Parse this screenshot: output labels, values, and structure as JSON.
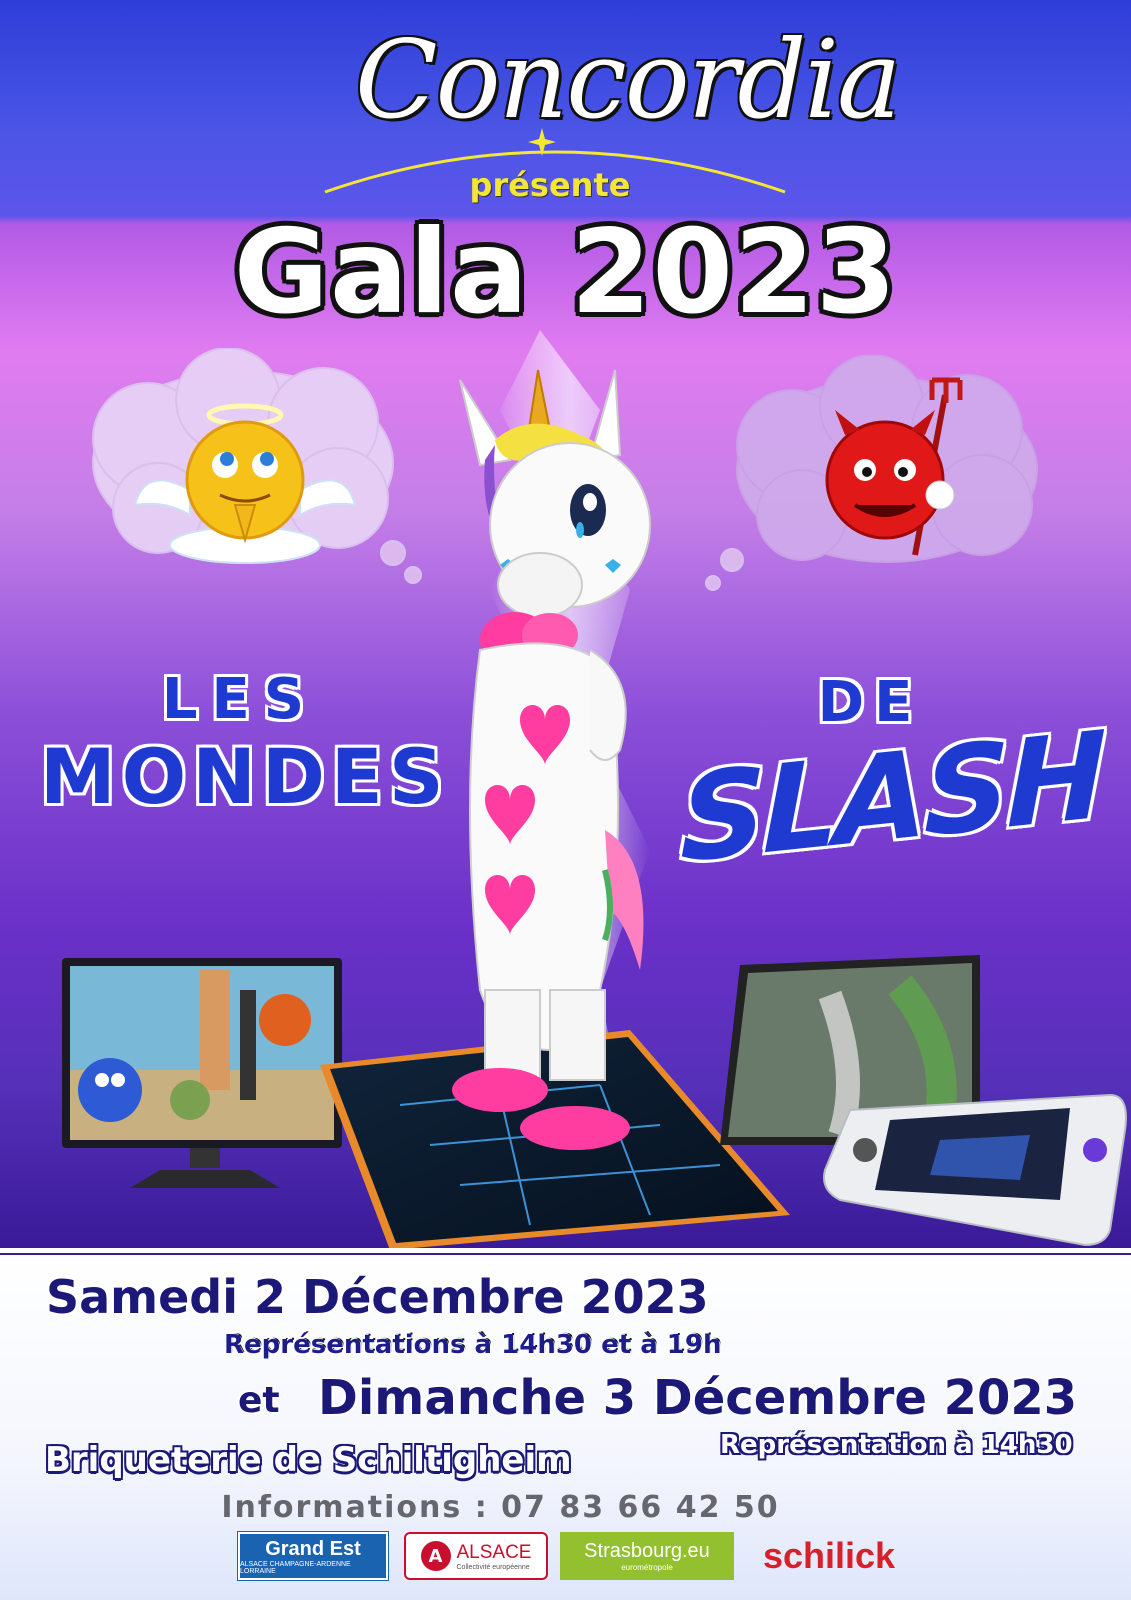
{
  "header": {
    "brand": "Concordia",
    "presents": "présente",
    "title": "Gala 2023"
  },
  "show": {
    "title_line1": "LES",
    "title_line2": "MONDES",
    "title_line3": "DE",
    "title_line4": "SLASH"
  },
  "dates": {
    "saturday": "Samedi 2 Décembre 2023",
    "saturday_times": "Représentations à 14h30 et à 19h",
    "conjunction": "et",
    "sunday": "Dimanche 3 Décembre 2023",
    "sunday_times": "Représentation à 14h30",
    "venue": "Briqueterie de Schiltigheim"
  },
  "info": "Informations : 07 83 66 42 50",
  "sponsors": {
    "grandest": "Grand Est",
    "grandest_sub": "ALSACE CHAMPAGNE-ARDENNE LORRAINE",
    "alsace": "ALSACE",
    "alsace_sub": "Collectivité européenne",
    "strasbourg": "Strasbourg.eu",
    "strasbourg_sub": "eurométropole",
    "schilick": "schilick"
  },
  "colors": {
    "title_blue": "#1f3ad0",
    "date_navy": "#1c1878",
    "presente_yellow": "#f4e634",
    "heart_pink": "#ff3da0"
  },
  "icons": [
    "angel-emoji-icon",
    "devil-emoji-icon",
    "unicorn-mascot",
    "tv-screen",
    "smartphone",
    "laptop",
    "handheld-console"
  ]
}
